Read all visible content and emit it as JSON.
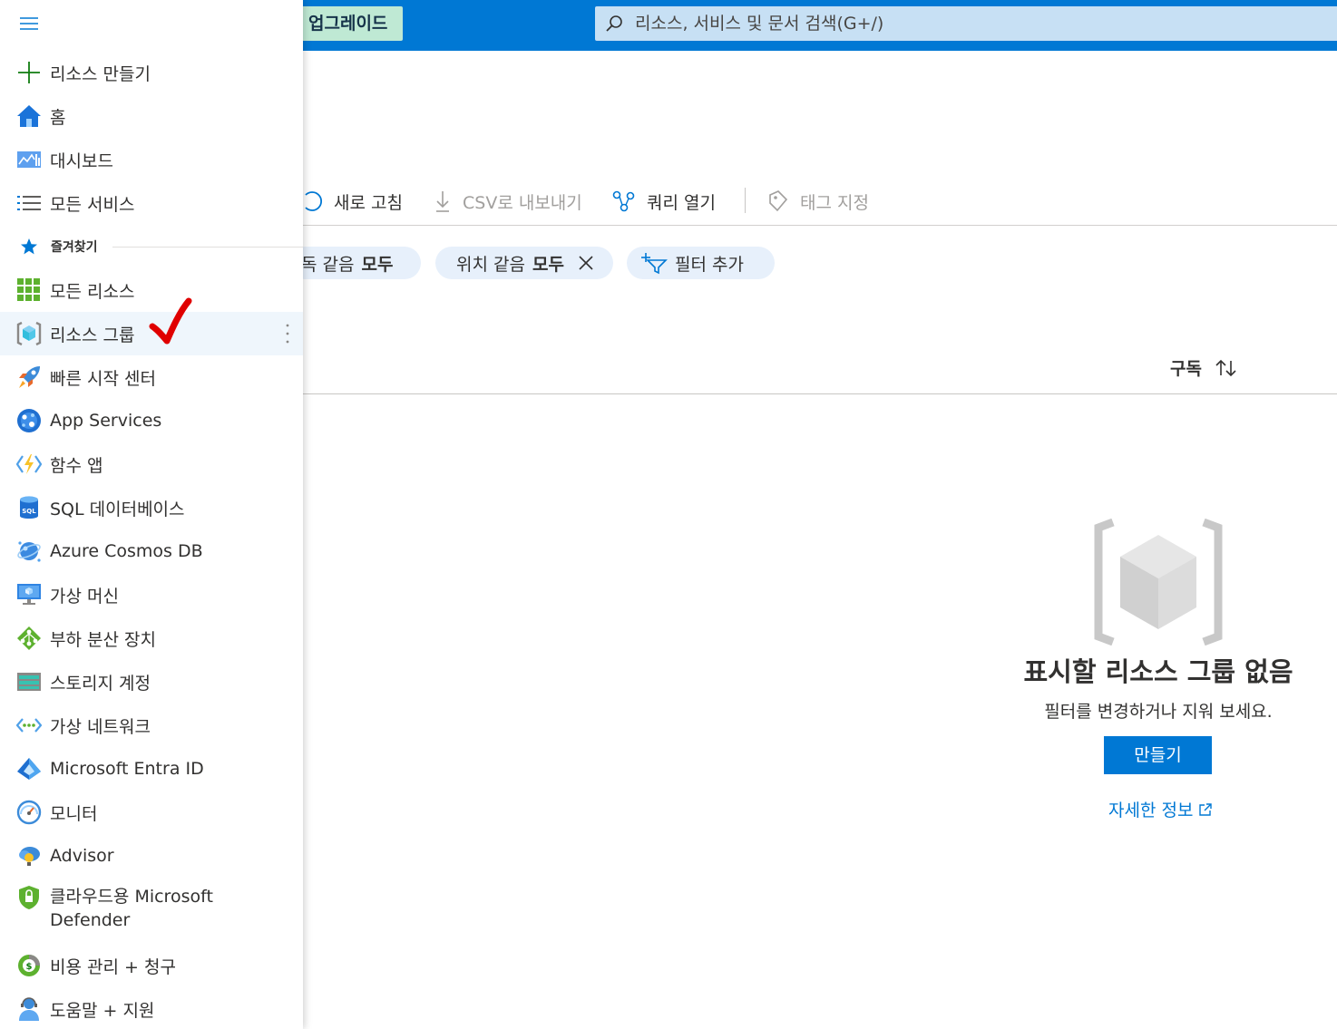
{
  "topbar": {
    "upgrade_label": "업그레이드",
    "search_placeholder": "리소스, 서비스 및 문서 검색(G+/)"
  },
  "toolbar": {
    "refresh": "새로 고침",
    "export_csv": "CSV로 내보내기",
    "open_query": "쿼리 열기",
    "assign_tags": "태그 지정"
  },
  "filters": [
    {
      "label": "독 같음",
      "value": "모두"
    },
    {
      "label": "위치 같음",
      "value": "모두"
    },
    {
      "label": "필터 추가"
    }
  ],
  "table": {
    "subscription_header": "구독"
  },
  "empty_state": {
    "title": "표시할 리소스 그룹 없음",
    "subtitle": "필터를 변경하거나 지워 보세요.",
    "create_label": "만들기",
    "learn_more": "자세한 정보"
  },
  "sidenav": {
    "favorites_header": "즐겨찾기",
    "items": [
      {
        "label": "리소스 만들기",
        "icon": "plus-icon"
      },
      {
        "label": "홈",
        "icon": "home-icon"
      },
      {
        "label": "대시보드",
        "icon": "dashboard-icon"
      },
      {
        "label": "모든 서비스",
        "icon": "list-icon"
      },
      {
        "label": "모든 리소스",
        "icon": "grid-icon"
      },
      {
        "label": "리소스 그룹",
        "icon": "resource-group-icon",
        "selected": true
      },
      {
        "label": "빠른 시작 센터",
        "icon": "rocket-icon"
      },
      {
        "label": "App Services",
        "icon": "app-services-icon"
      },
      {
        "label": "함수 앱",
        "icon": "function-icon"
      },
      {
        "label": "SQL 데이터베이스",
        "icon": "sql-database-icon"
      },
      {
        "label": "Azure Cosmos DB",
        "icon": "cosmos-db-icon"
      },
      {
        "label": "가상 머신",
        "icon": "virtual-machine-icon"
      },
      {
        "label": "부하 분산 장치",
        "icon": "load-balancer-icon"
      },
      {
        "label": "스토리지 계정",
        "icon": "storage-icon"
      },
      {
        "label": "가상 네트워크",
        "icon": "virtual-network-icon"
      },
      {
        "label": "Microsoft Entra ID",
        "icon": "entra-id-icon"
      },
      {
        "label": "모니터",
        "icon": "monitor-icon"
      },
      {
        "label": "Advisor",
        "icon": "advisor-icon"
      },
      {
        "label": "클라우드용 Microsoft Defender",
        "icon": "defender-icon"
      },
      {
        "label": "비용 관리 + 청구",
        "icon": "cost-management-icon"
      },
      {
        "label": "도움말 + 지원",
        "icon": "help-support-icon"
      }
    ]
  },
  "colors": {
    "azure_blue": "#0078d4",
    "upgrade_bg": "#bfe9d4",
    "search_bg": "#c7e0f4",
    "pill_bg": "#e7f0fb",
    "selected_bg": "#eff6fc",
    "annotation_red": "#e00000"
  }
}
